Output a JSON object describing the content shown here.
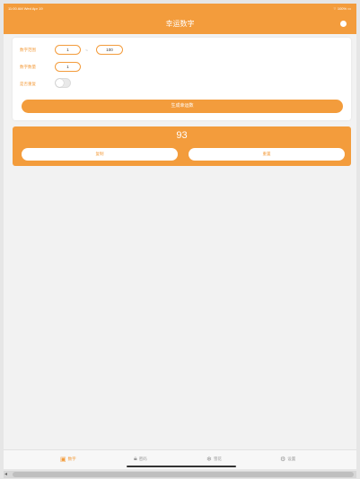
{
  "status_bar": {
    "time_date": "11:00 AM   Wed Apr 19",
    "battery": "100%"
  },
  "nav": {
    "title": "幸运数字"
  },
  "settings": {
    "range_label": "数字范围",
    "range_min": "1",
    "range_separator": "~",
    "range_max": "100",
    "count_label": "数字数量",
    "count_value": "1",
    "repeat_label": "是否重复",
    "repeat_on": false,
    "generate_button": "生成幸运数"
  },
  "result": {
    "value": "93",
    "copy_button": "复制",
    "reset_button": "重置"
  },
  "tabs": [
    {
      "label": "数字",
      "icon": "number-grid-icon",
      "active": true
    },
    {
      "label": "密码",
      "icon": "lock-icon",
      "active": false
    },
    {
      "label": "雪花",
      "icon": "snowflake-icon",
      "active": false
    },
    {
      "label": "设置",
      "icon": "gear-icon",
      "active": false
    }
  ],
  "colors": {
    "accent": "#f39c3c",
    "background": "#f2f2f2"
  }
}
